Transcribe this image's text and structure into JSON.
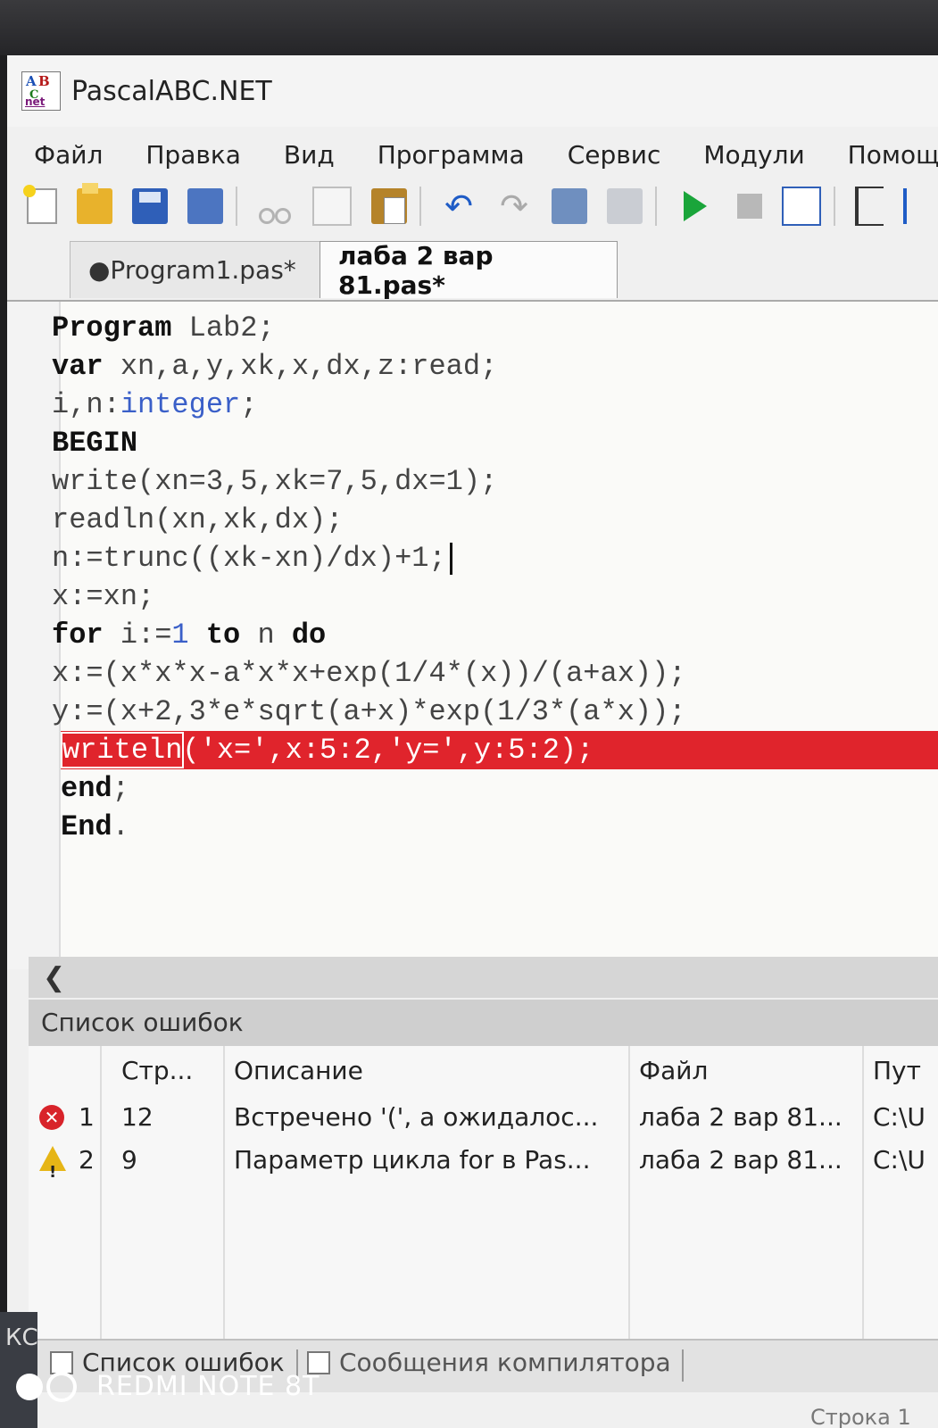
{
  "window": {
    "title": "PascalABC.NET",
    "logo_text": "ABC.net"
  },
  "menu": [
    "Файл",
    "Правка",
    "Вид",
    "Программа",
    "Сервис",
    "Модули",
    "Помощь"
  ],
  "toolbar_icons": [
    "new-file-icon",
    "open-folder-icon",
    "save-icon",
    "save-all-icon",
    "cut-icon",
    "copy-icon",
    "paste-icon",
    "undo-icon",
    "redo-icon",
    "command-icon",
    "command2-icon",
    "run-icon",
    "stop-icon",
    "build-icon",
    "step-icon",
    "step-over-icon"
  ],
  "tabs": [
    {
      "label": "●Program1.pas*",
      "active": false
    },
    {
      "label": "лаба 2 вар 81.pas*",
      "active": true
    }
  ],
  "code": {
    "l1_kw": "Program",
    "l1_rest": " Lab2;",
    "l2_kw": "var",
    "l2_rest": " xn,a,y,xk,x,dx,z:read;",
    "l3_a": "i,n:",
    "l3_type": "integer",
    "l3_b": ";",
    "l4_kw": "BEGIN",
    "l5": "write(xn=3,5,xk=7,5,dx=1);",
    "l6": "readln(xn,xk,dx);",
    "l7": "n:=trunc((xk-xn)/dx)+1;",
    "l8": "x:=xn;",
    "l9_kw1": "for",
    "l9_a": " i:=",
    "l9_num": "1",
    "l9_b": " ",
    "l9_kw2": "to",
    "l9_c": " n ",
    "l9_kw3": "do",
    "l10": "x:=(x*x*x-a*x*x+exp(1/4*(x))/(a+ax));",
    "l11": "y:=(x+2,3*e*sqrt(a+x)*exp(1/3*(a*x));",
    "l12_tok": "writeln",
    "l12_rest": "('x=',x:5:2,'y=',y:5:2);",
    "l13_kw": "end",
    "l13_rest": ";",
    "l14_kw": "End",
    "l14_rest": ".",
    "error_line": 12
  },
  "error_panel": {
    "title": "Список ошибок",
    "columns": [
      "Стр...",
      "Описание",
      "Файл",
      "Пут"
    ],
    "rows": [
      {
        "severity": "error",
        "num": "1",
        "line": "12",
        "description": "Встречено '(', а ожидалос...",
        "file": "лаба 2 вар 81...",
        "path": "C:\\U"
      },
      {
        "severity": "warning",
        "num": "2",
        "line": "9",
        "description": "Параметр цикла for в Pas...",
        "file": "лаба 2 вар 81...",
        "path": "C:\\U"
      }
    ]
  },
  "bottom_tabs": [
    "Список ошибок",
    "Сообщения компилятора"
  ],
  "status_partial": "Строка 1",
  "photo_watermark": "REDMI NOTE 8T",
  "side_text": "КС",
  "colors": {
    "error_line": "#e0242c",
    "keyword": "#111111",
    "type": "#3a5fc8",
    "run": "#1aa53a"
  }
}
